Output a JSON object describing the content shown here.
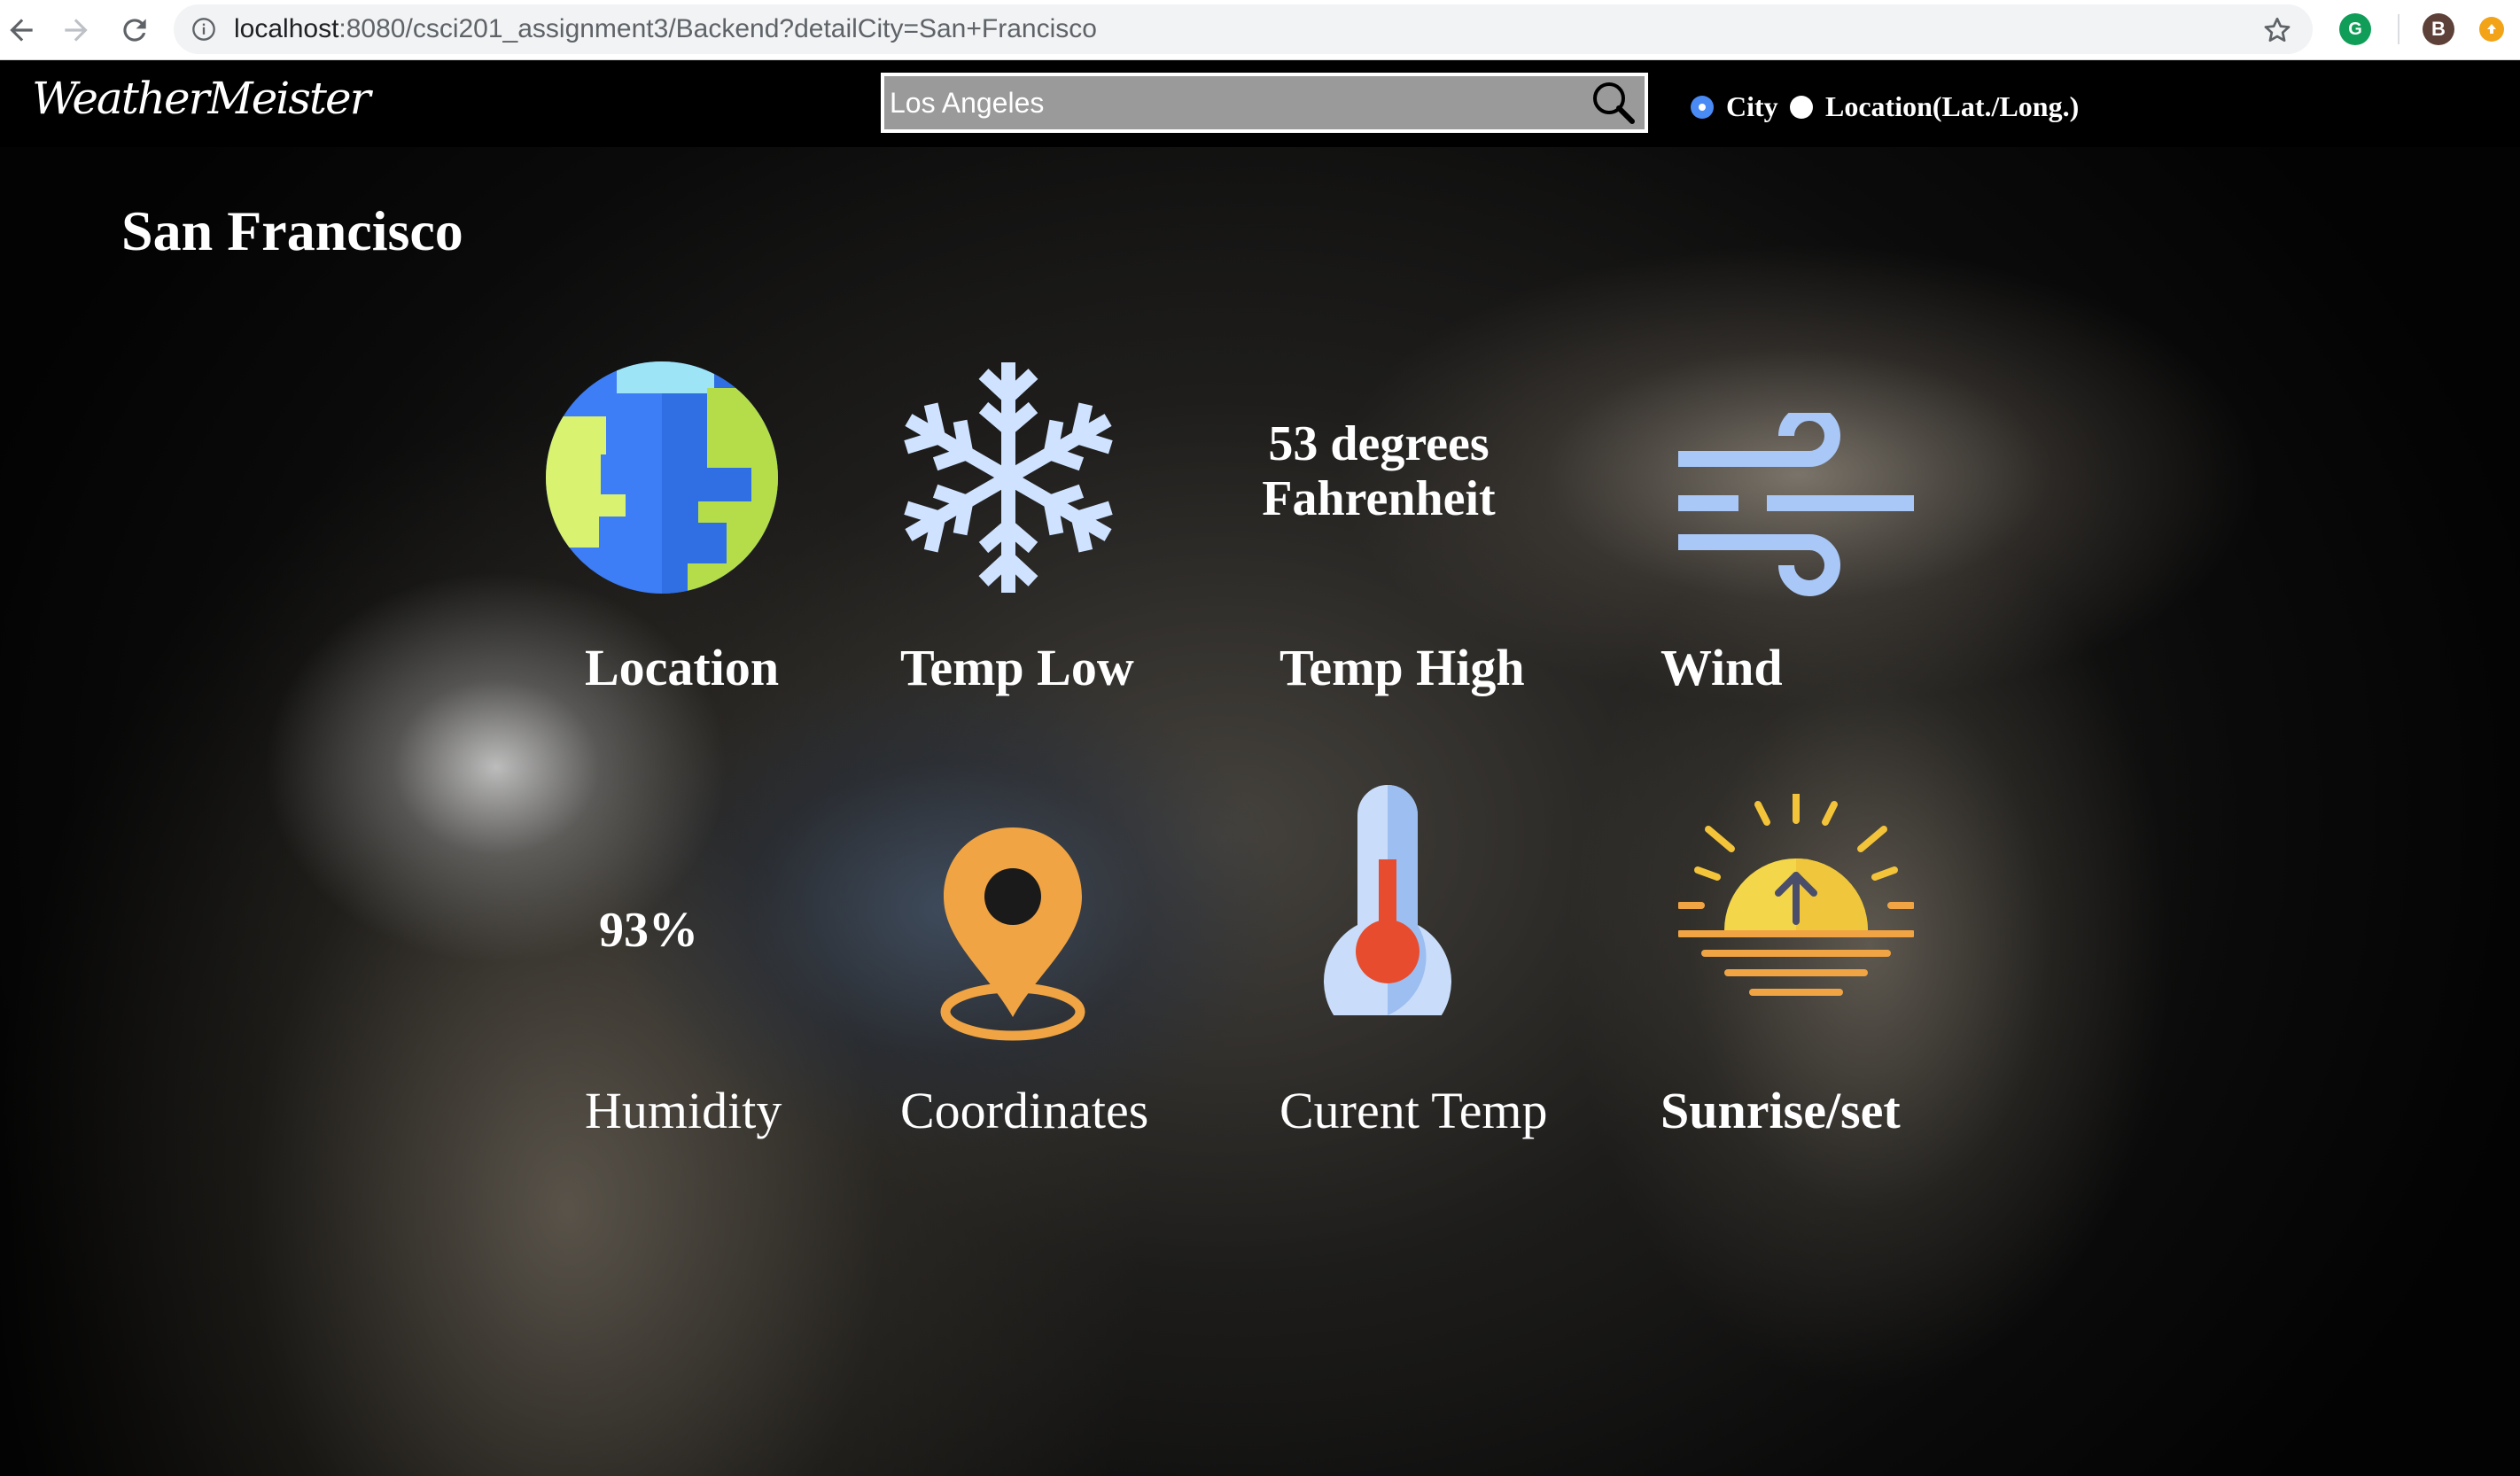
{
  "browser": {
    "url_host": "localhost",
    "url_path": ":8080/csci201_assignment3/Backend?detailCity=San+Francisco",
    "profile_initial": "B",
    "extension_g_letter": "G"
  },
  "header": {
    "logo": "WeatherMeister",
    "search_value": "Los Angeles",
    "radio_city_label": "City",
    "radio_location_label": "Location(Lat./Long.)",
    "selected_mode": "City"
  },
  "detail": {
    "city": "San Francisco",
    "tiles": [
      {
        "label": "Location",
        "icon": "globe-icon"
      },
      {
        "label": "Temp Low",
        "icon": "snowflake-icon"
      },
      {
        "label": "Temp High",
        "value_line1": "53 degrees",
        "value_line2": "Fahrenheit"
      },
      {
        "label": "Wind",
        "icon": "wind-icon"
      },
      {
        "label": "Humidity",
        "value": "93%"
      },
      {
        "label": "Coordinates",
        "icon": "map-pin-icon"
      },
      {
        "label": "Curent Temp",
        "icon": "thermometer-icon"
      },
      {
        "label": "Sunrise/set",
        "icon": "sunrise-icon"
      }
    ]
  },
  "colors": {
    "globe_ocean": "#3d7df5",
    "globe_land": "#b5dd4a",
    "snowflake": "#cfe2ff",
    "wind": "#a9c7f7",
    "pin": "#f1a443",
    "thermometer_body": "#c9ddfa",
    "thermometer_mercury": "#e74c2f",
    "sun": "#f3c33a",
    "radio_accent": "#4a8af4"
  }
}
